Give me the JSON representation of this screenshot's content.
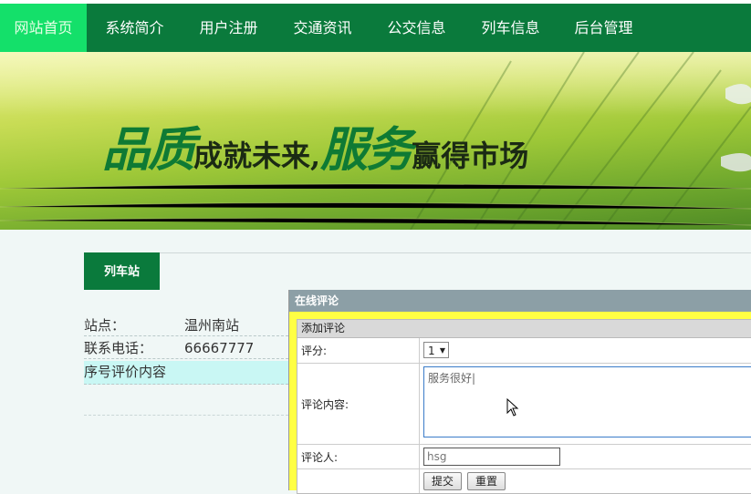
{
  "nav": {
    "items": [
      {
        "label": "网站首页",
        "active": true
      },
      {
        "label": "系统简介",
        "active": false
      },
      {
        "label": "用户注册",
        "active": false
      },
      {
        "label": "交通资讯",
        "active": false
      },
      {
        "label": "公交信息",
        "active": false
      },
      {
        "label": "列车信息",
        "active": false
      },
      {
        "label": "后台管理",
        "active": false
      }
    ]
  },
  "banner": {
    "slogan_big_1": "品质",
    "slogan_small_1": "成就未来,",
    "slogan_big_2": "服务",
    "slogan_small_2": "赢得市场"
  },
  "station_tab": "列车站",
  "info": {
    "station_label": "站点：",
    "station_value": "温州南站",
    "phone_label": "联系电话：",
    "phone_value": "66667777",
    "comment_header": "序号评价内容"
  },
  "dialog": {
    "title": "在线评论",
    "form_title": "添加评论",
    "score_label": "评分:",
    "score_value": "1",
    "content_label": "评论内容:",
    "content_value": "服务很好|",
    "commenter_label": "评论人:",
    "commenter_value": "hsg",
    "submit_label": "提交",
    "reset_label": "重置"
  },
  "colors": {
    "nav_bg": "#0a7a3c",
    "nav_active": "#14e06a",
    "dialog_bg": "#ffff44",
    "dialog_title": "#8c9fa6"
  }
}
